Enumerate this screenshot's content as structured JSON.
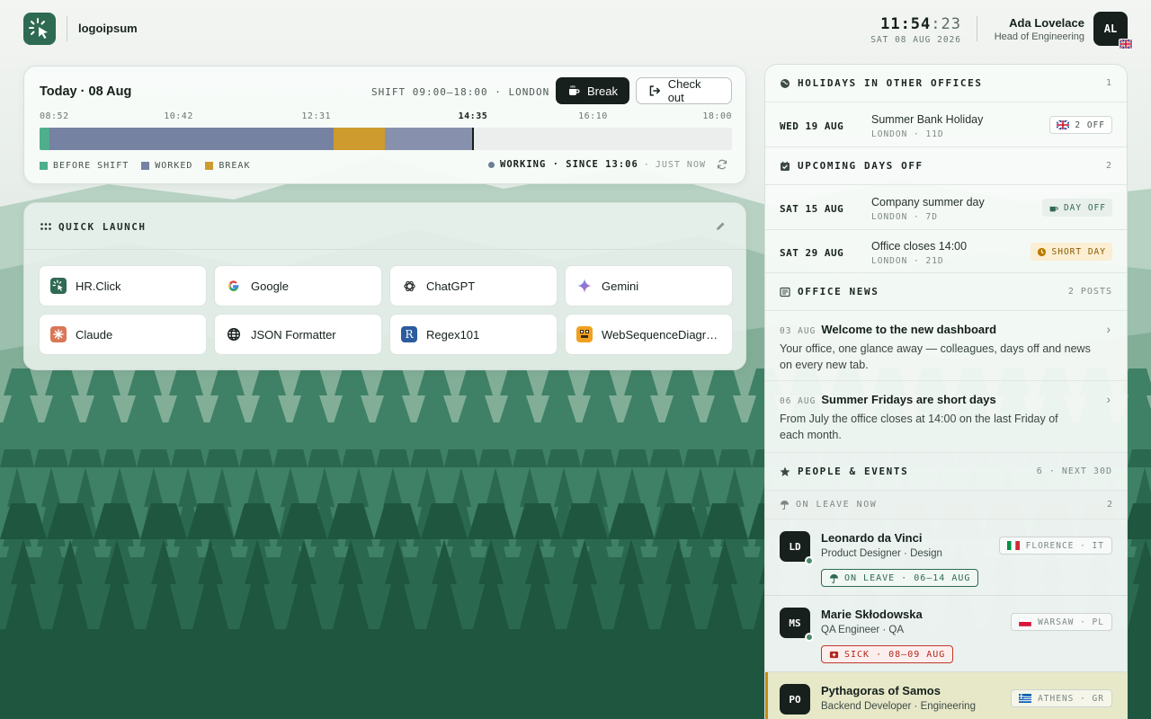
{
  "theme": {
    "accent": "#2f6a52",
    "dark": "#17201c",
    "before_shift": "#4fae8c",
    "worked": "#7682a1",
    "break": "#cd9b2e"
  },
  "header": {
    "logo_text": "logoipsum",
    "clock_hm": "11:54",
    "clock_sec": ":23",
    "clock_date": "SAT 08 AUG 2026",
    "user_name": "Ada Lovelace",
    "user_role": "Head of Engineering",
    "user_initials": "AL",
    "user_flag": "uk-flag-icon"
  },
  "today": {
    "title": "Today · 08 Aug",
    "shift": "SHIFT 09:00–18:00 · LONDON",
    "break_label": "Break",
    "checkout_label": "Check out",
    "timeline_labels": [
      "08:52",
      "10:42",
      "12:31",
      "14:35",
      "16:10",
      "18:00"
    ],
    "timeline_segments": [
      {
        "kind": "before_shift",
        "start": "08:52",
        "end": "09:00"
      },
      {
        "kind": "worked",
        "start": "09:00",
        "end": "12:45"
      },
      {
        "kind": "break",
        "start": "12:45",
        "end": "13:25"
      },
      {
        "kind": "worked_current",
        "start": "13:25",
        "end": "14:35"
      }
    ],
    "now": "14:35",
    "legend": [
      "BEFORE SHIFT",
      "WORKED",
      "BREAK"
    ],
    "status_main": "WORKING · SINCE 13:06",
    "status_sep": "·",
    "status_updated": "JUST NOW"
  },
  "quick_launch": {
    "title": "QUICK LAUNCH",
    "items": [
      {
        "label": "HR.Click",
        "icon": "hrclick-icon"
      },
      {
        "label": "Google",
        "icon": "google-icon"
      },
      {
        "label": "ChatGPT",
        "icon": "chatgpt-icon"
      },
      {
        "label": "Gemini",
        "icon": "gemini-icon"
      },
      {
        "label": "Claude",
        "icon": "claude-icon"
      },
      {
        "label": "JSON Formatter",
        "icon": "globe-icon"
      },
      {
        "label": "Regex101",
        "icon": "regex101-icon"
      },
      {
        "label": "WebSequenceDiagrams",
        "icon": "websequencediagrams-icon"
      }
    ]
  },
  "holidays": {
    "title": "HOLIDAYS IN OTHER OFFICES",
    "count": "1",
    "items": [
      {
        "date": "WED 19 AUG",
        "title": "Summer Bank Holiday",
        "sub": "LONDON · 11D",
        "badge": "2 OFF"
      }
    ]
  },
  "days_off": {
    "title": "UPCOMING DAYS OFF",
    "count": "2",
    "items": [
      {
        "date": "SAT 15 AUG",
        "title": "Company summer day",
        "sub": "LONDON · 7D",
        "badge": "DAY OFF"
      },
      {
        "date": "SAT 29 AUG",
        "title": "Office closes 14:00",
        "sub": "LONDON · 21D",
        "badge": "SHORT DAY"
      }
    ]
  },
  "news": {
    "title": "OFFICE NEWS",
    "count": "2 POSTS",
    "items": [
      {
        "date": "03 AUG",
        "title": "Welcome to the new dashboard",
        "body": "Your office, one glance away — colleagues, days off and news on every new tab."
      },
      {
        "date": "06 AUG",
        "title": "Summer Fridays are short days",
        "body": "From July the office closes at 14:00 on the last Friday of each month."
      }
    ]
  },
  "people": {
    "title": "PEOPLE & EVENTS",
    "count": "6 · NEXT 30D",
    "on_leave_title": "ON LEAVE NOW",
    "on_leave_count": "2",
    "items": [
      {
        "initials": "LD",
        "name": "Leonardo da Vinci",
        "role": "Product Designer · Design",
        "location": "FLORENCE · IT",
        "badge": "ON LEAVE · 06–14 AUG"
      },
      {
        "initials": "MS",
        "name": "Marie Skłodowska",
        "role": "QA Engineer · QA",
        "location": "WARSAW · PL",
        "badge": "SICK · 08–09 AUG"
      },
      {
        "initials": "PO",
        "name": "Pythagoras of Samos",
        "role": "Backend Developer · Engineering",
        "location": "ATHENS · GR",
        "badge": ""
      }
    ]
  }
}
